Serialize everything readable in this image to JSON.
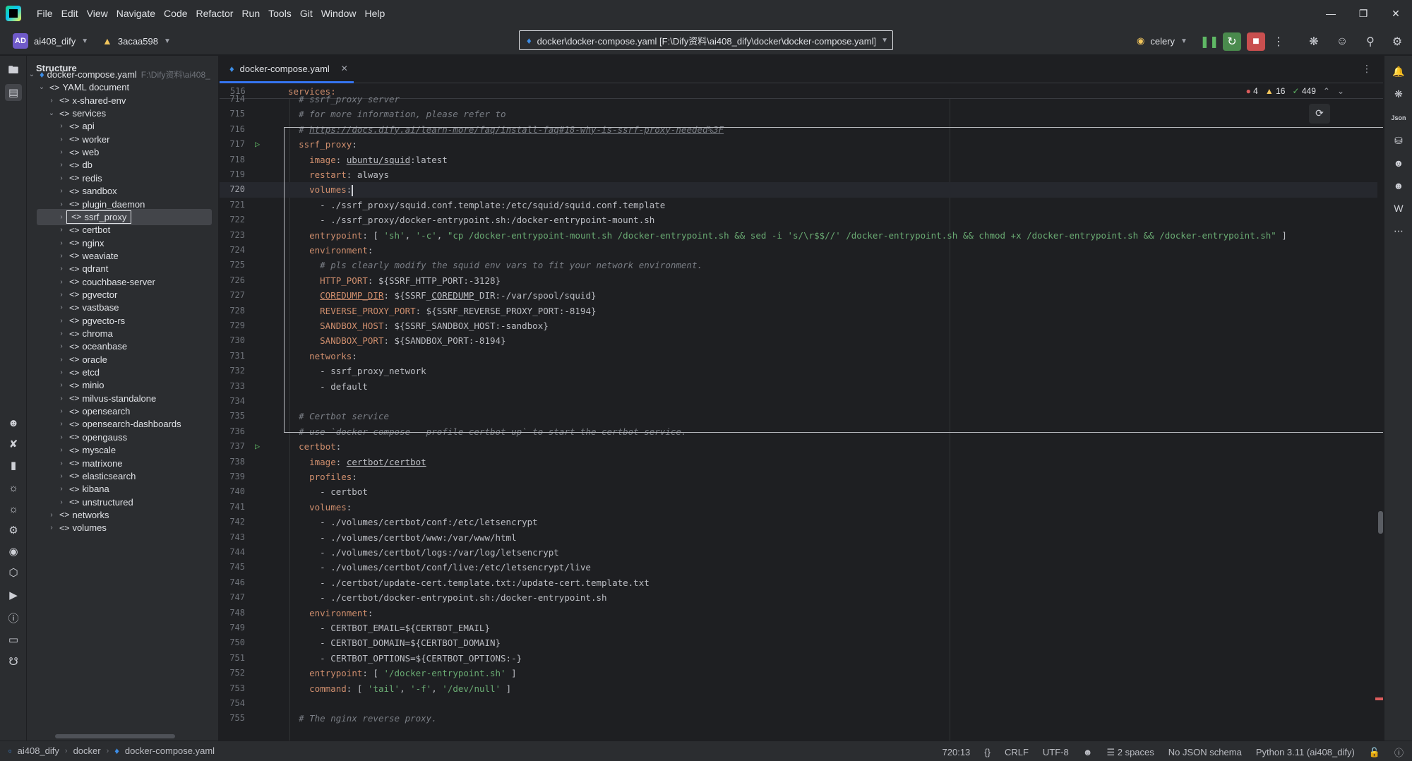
{
  "menu": [
    "File",
    "Edit",
    "View",
    "Navigate",
    "Code",
    "Refactor",
    "Run",
    "Tools",
    "Git",
    "Window",
    "Help"
  ],
  "toolbar": {
    "project_badge": "AD",
    "project_name": "ai408_dify",
    "vcs_branch": "3acaa598",
    "path": "docker\\docker-compose.yaml [F:\\Dify资料\\ai408_dify\\docker\\docker-compose.yaml]",
    "run_config": "celery"
  },
  "structure": {
    "title": "Structure",
    "file": "docker-compose.yaml",
    "file_path_hint": "F:\\Dify资料\\ai408_",
    "doc": "YAML document",
    "tag": "<>",
    "top_items": [
      "x-shared-env",
      "services"
    ],
    "services": [
      "api",
      "worker",
      "web",
      "db",
      "redis",
      "sandbox",
      "plugin_daemon",
      "ssrf_proxy",
      "certbot",
      "nginx",
      "weaviate",
      "qdrant",
      "couchbase-server",
      "pgvector",
      "vastbase",
      "pgvecto-rs",
      "chroma",
      "oceanbase",
      "oracle",
      "etcd",
      "minio",
      "milvus-standalone",
      "opensearch",
      "opensearch-dashboards",
      "opengauss",
      "myscale",
      "matrixone",
      "elasticsearch",
      "kibana",
      "unstructured"
    ],
    "bottom_items": [
      "networks",
      "volumes"
    ],
    "selected": "ssrf_proxy"
  },
  "editor": {
    "tab": "docker-compose.yaml",
    "sticky_line_number": "516",
    "sticky_text": "services:",
    "inspections": {
      "errors": "4",
      "warnings": "16",
      "ok": "449"
    },
    "current_line": "720"
  },
  "code_lines": [
    {
      "n": "714",
      "html": "  <span class=\"c\"># ssrf_proxy server</span>"
    },
    {
      "n": "715",
      "html": "  <span class=\"c\"># for more information, please refer to</span>"
    },
    {
      "n": "716",
      "html": "  <span class=\"c\"># </span><span class=\"u\">https://docs.dify.ai/learn-more/faq/install-faq#18-why-is-ssrf-proxy-needed%3F</span>"
    },
    {
      "n": "717",
      "run": true,
      "html": "  <span class=\"k\">ssrf_proxy</span>:"
    },
    {
      "n": "718",
      "html": "    <span class=\"k\">image</span>: <span class=\"ul\">ubuntu/squid</span>:latest"
    },
    {
      "n": "719",
      "html": "    <span class=\"k\">restart</span>: always"
    },
    {
      "n": "720",
      "current": true,
      "html": "    <span class=\"k\">volumes</span>:<span class=\"caret\"></span>"
    },
    {
      "n": "721",
      "html": "      - ./ssrf_proxy/squid.conf.template:/etc/squid/squid.conf.template"
    },
    {
      "n": "722",
      "html": "      - ./ssrf_proxy/docker-entrypoint.sh:/docker-entrypoint-mount.sh"
    },
    {
      "n": "723",
      "html": "    <span class=\"k\">entrypoint</span>: [ <span class=\"s\">'sh'</span>, <span class=\"s\">'-c'</span>, <span class=\"s\">\"cp /docker-entrypoint-mount.sh /docker-entrypoint.sh &amp;&amp; sed -i 's/\\r$$//' /docker-entrypoint.sh &amp;&amp; chmod +x /docker-entrypoint.sh &amp;&amp; /docker-entrypoint.sh\"</span> ]"
    },
    {
      "n": "724",
      "html": "    <span class=\"k\">environment</span>:"
    },
    {
      "n": "725",
      "html": "      <span class=\"c\"># pls clearly modify the squid env vars to fit your network environment.</span>"
    },
    {
      "n": "726",
      "html": "      <span class=\"k\">HTTP_PORT</span>: ${SSRF_HTTP_PORT:-3128}"
    },
    {
      "n": "727",
      "html": "      <span class=\"k ul\">COREDUMP_DIR</span>: ${SSRF_<span class=\"ul\">COREDUMP</span>_DIR:-/var/spool/squid}"
    },
    {
      "n": "728",
      "html": "      <span class=\"k\">REVERSE_PROXY_PORT</span>: ${SSRF_REVERSE_PROXY_PORT:-8194}"
    },
    {
      "n": "729",
      "html": "      <span class=\"k\">SANDBOX_HOST</span>: ${SSRF_SANDBOX_HOST:-sandbox}"
    },
    {
      "n": "730",
      "html": "      <span class=\"k\">SANDBOX_PORT</span>: ${SANDBOX_PORT:-8194}"
    },
    {
      "n": "731",
      "html": "    <span class=\"k\">networks</span>:"
    },
    {
      "n": "732",
      "html": "      - ssrf_proxy_network"
    },
    {
      "n": "733",
      "html": "      - default"
    },
    {
      "n": "734",
      "html": ""
    },
    {
      "n": "735",
      "html": "  <span class=\"c\"># Certbot service</span>"
    },
    {
      "n": "736",
      "html": "  <span class=\"c\"># use `docker-compose --profile certbot up` to start the certbot service.</span>"
    },
    {
      "n": "737",
      "run": true,
      "html": "  <span class=\"k\">certbot</span>:"
    },
    {
      "n": "738",
      "html": "    <span class=\"k\">image</span>: <span class=\"ul\">certbot/certbot</span>"
    },
    {
      "n": "739",
      "html": "    <span class=\"k\">profiles</span>:"
    },
    {
      "n": "740",
      "html": "      - certbot"
    },
    {
      "n": "741",
      "html": "    <span class=\"k\">volumes</span>:"
    },
    {
      "n": "742",
      "html": "      - ./volumes/certbot/conf:/etc/letsencrypt"
    },
    {
      "n": "743",
      "html": "      - ./volumes/certbot/www:/var/www/html"
    },
    {
      "n": "744",
      "html": "      - ./volumes/certbot/logs:/var/log/letsencrypt"
    },
    {
      "n": "745",
      "html": "      - ./volumes/certbot/conf/live:/etc/letsencrypt/live"
    },
    {
      "n": "746",
      "html": "      - ./certbot/update-cert.template.txt:/update-cert.template.txt"
    },
    {
      "n": "747",
      "html": "      - ./certbot/docker-entrypoint.sh:/docker-entrypoint.sh"
    },
    {
      "n": "748",
      "html": "    <span class=\"k\">environment</span>:"
    },
    {
      "n": "749",
      "html": "      - CERTBOT_EMAIL=${CERTBOT_EMAIL}"
    },
    {
      "n": "750",
      "html": "      - CERTBOT_DOMAIN=${CERTBOT_DOMAIN}"
    },
    {
      "n": "751",
      "html": "      - CERTBOT_OPTIONS=${CERTBOT_OPTIONS:-}"
    },
    {
      "n": "752",
      "html": "    <span class=\"k\">entrypoint</span>: [ <span class=\"s\">'/docker-entrypoint.sh'</span> ]"
    },
    {
      "n": "753",
      "html": "    <span class=\"k\">command</span>: [ <span class=\"s\">'tail'</span>, <span class=\"s\">'-f'</span>, <span class=\"s\">'/dev/null'</span> ]"
    },
    {
      "n": "754",
      "html": ""
    },
    {
      "n": "755",
      "html": "  <span class=\"c\"># The nginx reverse proxy.</span>"
    }
  ],
  "statusbar": {
    "crumbs": [
      "ai408_dify",
      "docker",
      "docker-compose.yaml"
    ],
    "position": "720:13",
    "line_sep": "CRLF",
    "encoding": "UTF-8",
    "indent": "2 spaces",
    "schema": "No JSON schema",
    "interpreter": "Python 3.11 (ai408_dify)"
  },
  "right_strip": {
    "json_label": "Json"
  },
  "colors": {
    "accent": "#3574f0",
    "keyword": "#cf8e6d",
    "string": "#6aab73",
    "comment": "#7a7e85",
    "error": "#db5c5c",
    "warning": "#f2c55c"
  }
}
